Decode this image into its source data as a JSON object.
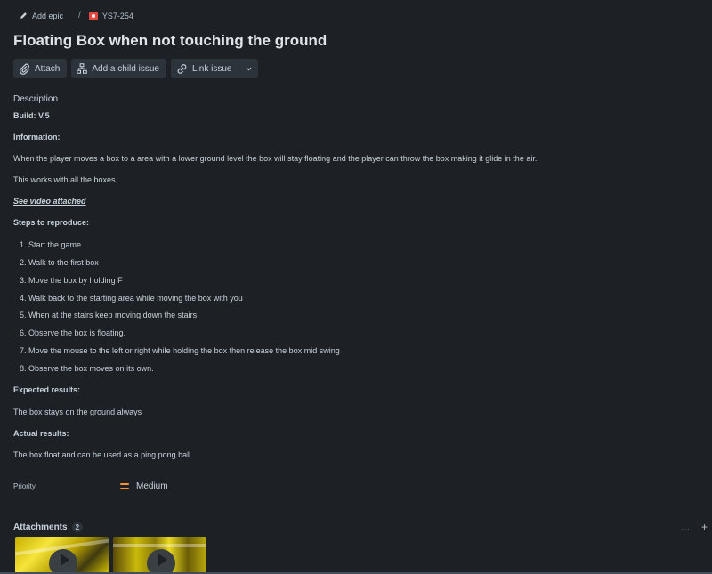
{
  "breadcrumb": {
    "epic_label": "Add epic",
    "separator": "/",
    "issue_key": "YS7-254"
  },
  "issue": {
    "title": "Floating Box when not touching the ground"
  },
  "toolbar": {
    "attach_label": "Attach",
    "child_issue_label": "Add a child issue",
    "link_issue_label": "Link issue"
  },
  "description": {
    "label": "Description",
    "build": "Build: V.5",
    "information_heading": "Information:",
    "information_text": "When the player moves a box to a area with a lower ground level the box will stay floating and the player can throw the box making it glide in the air.",
    "works_with": "This works with all the boxes",
    "video_link": "See video attached",
    "steps_heading": "Steps to reproduce:",
    "steps": [
      "1. Start the game",
      "2. Walk to the first box",
      "3. Move the box by holding F",
      "4. Walk back to the starting area while moving the box with you",
      "5. When at the stairs keep moving down the stairs",
      "6. Observe the box is floating.",
      "7. Move the mouse to the left or right while holding the box then release the box mid swing",
      "8. Observe the box moves on its own."
    ],
    "expected_heading": "Expected results:",
    "expected_text": "The box stays on the ground always",
    "actual_heading": "Actual results:",
    "actual_text": "The box float and can be used as a ping pong ball"
  },
  "priority": {
    "label": "Priority",
    "value": "Medium",
    "color": "#f79233"
  },
  "attachments": {
    "label": "Attachments",
    "count": "2",
    "more_icon": "…",
    "add_icon": "+",
    "items": [
      {
        "type": "video",
        "icon": "play-icon"
      },
      {
        "type": "video",
        "icon": "play-icon"
      }
    ]
  },
  "colors": {
    "background": "#1d2125",
    "text": "#c7d1db",
    "button_bg": "#2c333a",
    "bug_icon": "#e2483d"
  }
}
